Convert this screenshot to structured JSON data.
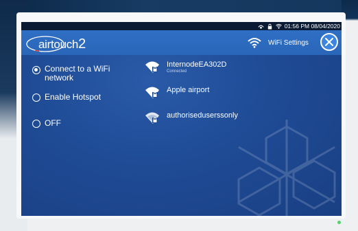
{
  "status_bar": {
    "time_date": "01:56 PM 08/04/2020"
  },
  "header": {
    "logo_text": "airtouch",
    "logo_number": "2",
    "title": "WiFi Settings"
  },
  "options": [
    {
      "label": "Connect to a WiFi network",
      "line1": "Connect to a WiFi",
      "line2": "network",
      "selected": true
    },
    {
      "label": "Enable Hotspot",
      "selected": false
    },
    {
      "label": "OFF",
      "selected": false
    }
  ],
  "networks": [
    {
      "name": "InternodeEA302D",
      "status": "Connected",
      "locked": true
    },
    {
      "name": "Apple airport",
      "status": "",
      "locked": true
    },
    {
      "name": "authoriseduser sonly",
      "display_name": "authoriseduserssonly",
      "status": "",
      "locked": true
    }
  ],
  "icons": {
    "status": [
      "signal-icon",
      "lock-icon",
      "wifi-icon"
    ],
    "close": "close-icon",
    "wifi": "wifi-icon"
  },
  "colors": {
    "accent": "#2a66b8",
    "screen": "#1f4b95",
    "statusbar": "#0b1a33"
  }
}
